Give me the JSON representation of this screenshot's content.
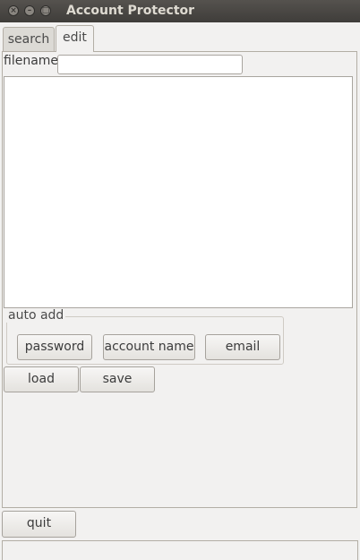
{
  "window": {
    "title": "Account Protector"
  },
  "tabs": [
    {
      "label": "search",
      "active": false
    },
    {
      "label": "edit",
      "active": true
    }
  ],
  "edit": {
    "filename_label": "filename",
    "filename_value": "",
    "auto_add_label": "auto add",
    "auto_add_buttons": [
      "password",
      "account name",
      "email"
    ],
    "load_label": "load",
    "save_label": "save"
  },
  "footer": {
    "quit_label": "quit"
  }
}
